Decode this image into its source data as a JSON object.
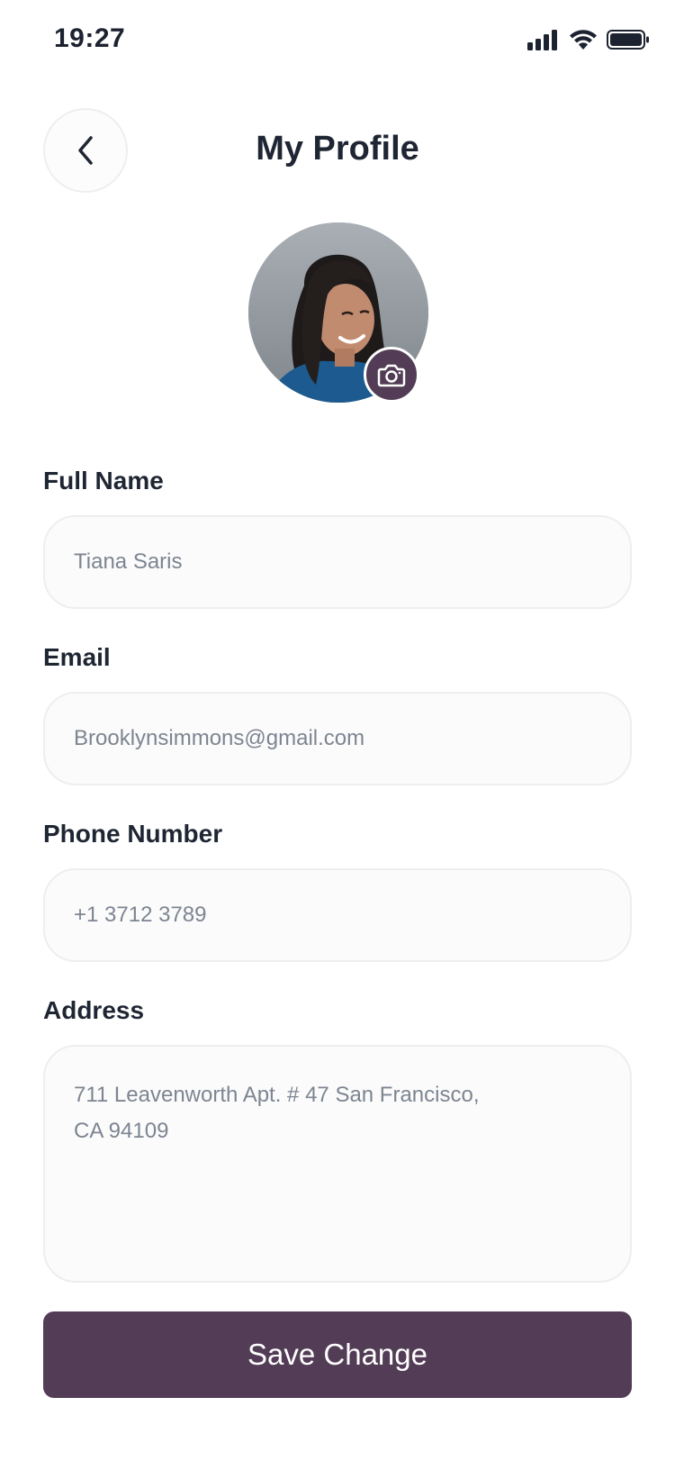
{
  "status_bar": {
    "time": "19:27"
  },
  "header": {
    "title": "My Profile"
  },
  "avatar": {
    "icon": "camera-icon"
  },
  "form": {
    "full_name": {
      "label": "Full Name",
      "value": "Tiana Saris"
    },
    "email": {
      "label": "Email",
      "value": "Brooklynsimmons@gmail.com"
    },
    "phone": {
      "label": "Phone Number",
      "value": "+1 3712 3789"
    },
    "address": {
      "label": "Address",
      "line1": "711 Leavenworth Apt. # 47 San Francisco,",
      "line2": "CA 94109"
    }
  },
  "save_button": {
    "label": "Save Change"
  },
  "colors": {
    "accent": "#533c56",
    "text": "#1f2633",
    "field_text": "#7d8591",
    "field_bg": "#fbfbfb",
    "field_border": "#eeeeee"
  }
}
